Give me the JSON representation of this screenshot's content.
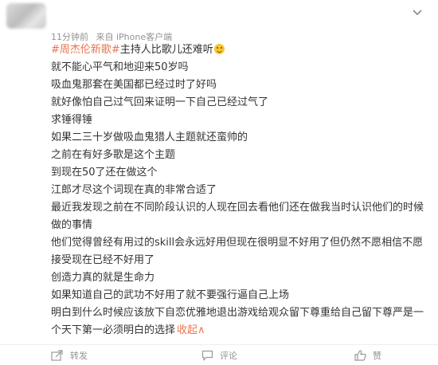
{
  "header": {
    "time": "11分钟前",
    "source": "来自 iPhone客户端"
  },
  "post": {
    "topic": "#周杰伦新歌#",
    "title_rest": "主持人比歌儿还难听",
    "lines": [
      "就不能心平气和地迎来50岁吗",
      "吸血鬼那套在美国都已经过时了好吗",
      "就好像怕自己过气回来证明一下自己已经过气了",
      "求锤得锤",
      "如果二三十岁做吸血鬼猎人主题就还蛮帅的",
      "之前在有好多歌是这个主题",
      "到现在50了还在做这个",
      "江郎才尽这个词现在真的非常合适了",
      "最近我发现之前在不同阶段认识的人现在回去看他们还在做我当时认识他们的时候做的事情",
      "他们觉得曾经有用过的skill会永远好用但现在很明显不好用了但仍然不愿相信不愿接受现在已经不好用了",
      "创造力真的就是生命力",
      "如果知道自己的武功不好用了就不要强行逼自己上场",
      "明白到什么时候应该放下自恋优雅地退出游戏给观众留下尊重给自己留下尊严是一个天下第一必须明白的选择"
    ],
    "collapse_label": "收起∧"
  },
  "actions": {
    "forward": "转发",
    "comment": "评论",
    "like": "赞"
  },
  "colors": {
    "accent": "#eb7350",
    "meta": "#939393",
    "text": "#333333"
  }
}
